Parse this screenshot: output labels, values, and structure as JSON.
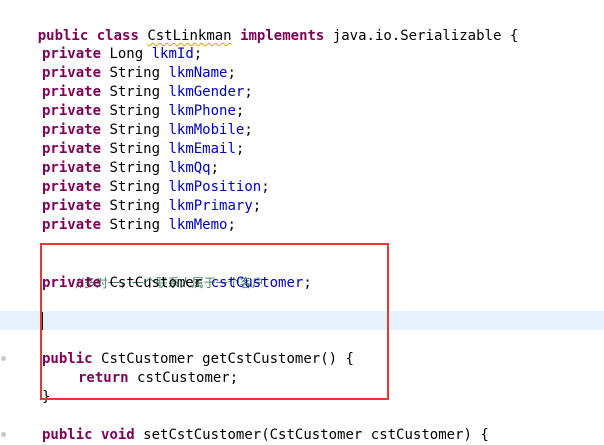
{
  "editor": {
    "class_decl": {
      "kw_public": "public",
      "kw_class": "class",
      "name": "CstLinkman",
      "kw_implements": "implements",
      "iface": "java.io.Serializable",
      "brace": "{"
    },
    "fields": [
      {
        "modifier": "private",
        "type": "Long",
        "name": "lkmId"
      },
      {
        "modifier": "private",
        "type": "String",
        "name": "lkmName"
      },
      {
        "modifier": "private",
        "type": "String",
        "name": "lkmGender"
      },
      {
        "modifier": "private",
        "type": "String",
        "name": "lkmPhone"
      },
      {
        "modifier": "private",
        "type": "String",
        "name": "lkmMobile"
      },
      {
        "modifier": "private",
        "type": "String",
        "name": "lkmEmail"
      },
      {
        "modifier": "private",
        "type": "String",
        "name": "lkmQq"
      },
      {
        "modifier": "private",
        "type": "String",
        "name": "lkmPosition"
      },
      {
        "modifier": "private",
        "type": "String",
        "name": "lkmPrimary"
      },
      {
        "modifier": "private",
        "type": "String",
        "name": "lkmMemo"
      }
    ],
    "comment": "//多对一，一个联系人属于一个客户",
    "relation_field": {
      "modifier": "private",
      "type": "CstCustomer",
      "name": "cstCustomer"
    },
    "getter": {
      "kw_public": "public",
      "return_type": "CstCustomer",
      "name": "getCstCustomer",
      "signature_tail": "() {",
      "kw_return": "return",
      "return_value": "cstCustomer;",
      "close_brace": "}"
    },
    "setter": {
      "kw_public": "public",
      "kw_void": "void",
      "name": "setCstCustomer",
      "params": "(CstCustomer cstCustomer) {"
    },
    "semicolon": ";"
  }
}
